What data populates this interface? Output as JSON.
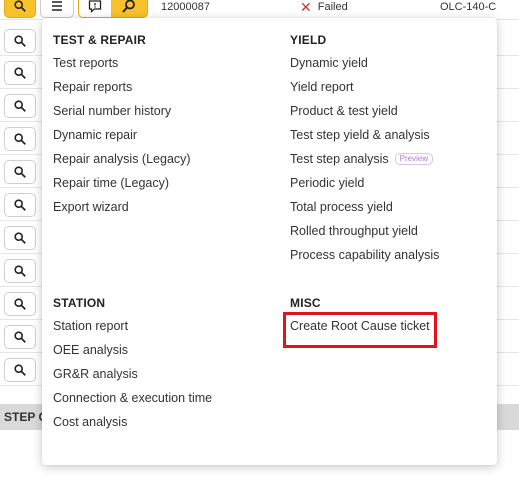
{
  "table": {
    "top_row": {
      "serial": "12000087",
      "status": "Failed",
      "part": "OLC-140-C"
    },
    "step_bar_label": "STEP C"
  },
  "menu": {
    "test_repair": {
      "title": "TEST & REPAIR",
      "items": [
        "Test reports",
        "Repair reports",
        "Serial number history",
        "Dynamic repair",
        "Repair analysis (Legacy)",
        "Repair time (Legacy)",
        "Export wizard"
      ]
    },
    "yield": {
      "title": "YIELD",
      "items": [
        "Dynamic yield",
        "Yield report",
        "Product & test yield",
        "Test step yield & analysis",
        "Test step analysis",
        "Periodic yield",
        "Total process yield",
        "Rolled throughput yield",
        "Process capability analysis"
      ],
      "preview_badge": "Preview"
    },
    "station": {
      "title": "STATION",
      "items": [
        "Station report",
        "OEE analysis",
        "GR&R analysis",
        "Connection & execution time",
        "Cost analysis"
      ]
    },
    "misc": {
      "title": "MISC",
      "items": [
        "Create Root Cause ticket"
      ]
    }
  },
  "colors": {
    "accent_yellow": "#f6c12b",
    "failed_red": "#d0312d",
    "highlight_red": "#e0141e",
    "preview_purple": "#b57ad0"
  }
}
